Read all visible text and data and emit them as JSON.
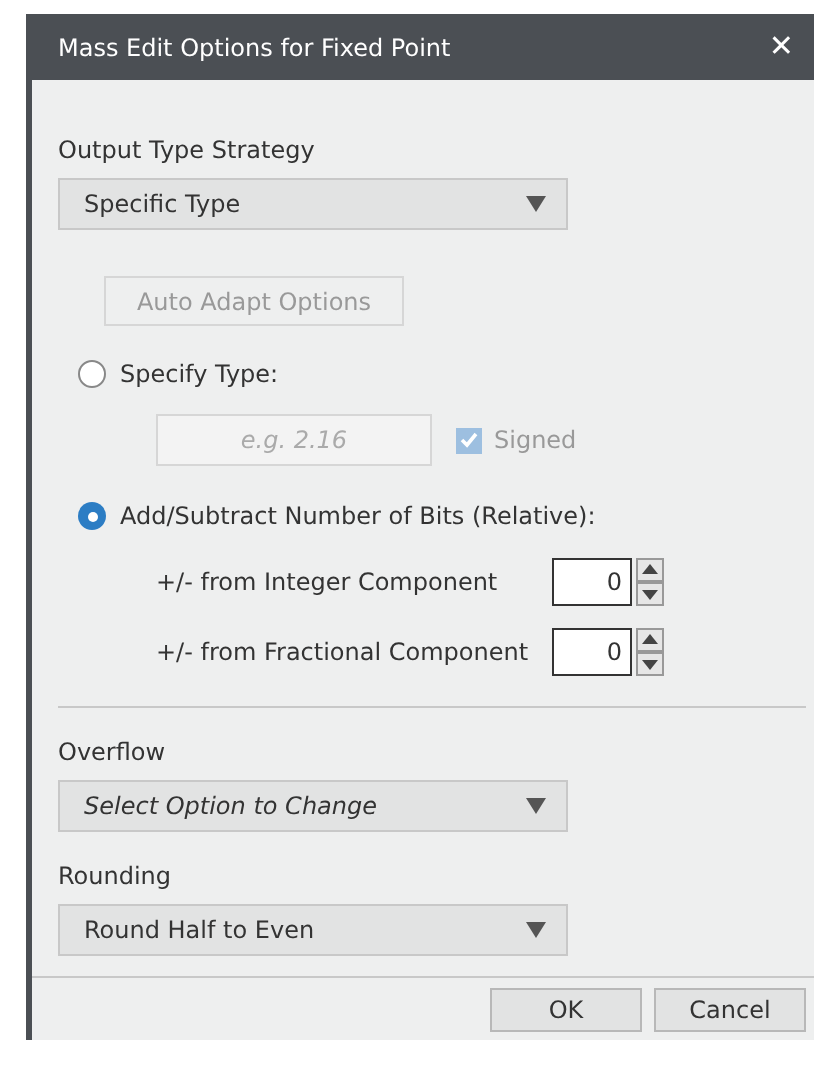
{
  "window": {
    "title": "Mass Edit Options for Fixed Point",
    "close": "✕"
  },
  "output_type": {
    "label": "Output Type Strategy",
    "value": "Specific Type"
  },
  "auto_adapt": {
    "label": "Auto Adapt Options",
    "disabled": true
  },
  "modes": [
    {
      "label": "Specify Type:",
      "selected": false
    },
    {
      "label": "Add/Subtract Number of Bits (Relative):",
      "selected": true
    }
  ],
  "type_field": {
    "placeholder": "e.g. 2.16",
    "disabled": true
  },
  "signed": {
    "label": "Signed",
    "checked": true,
    "disabled": true
  },
  "bits": [
    {
      "label": "+/- from Integer Component",
      "value": "0"
    },
    {
      "label": "+/- from Fractional Component",
      "value": "0"
    }
  ],
  "overflow": {
    "label": "Overflow",
    "placeholder": "Select Option to Change"
  },
  "rounding": {
    "label": "Rounding",
    "value": "Round Half to Even"
  },
  "buttons": [
    "OK",
    "Cancel"
  ]
}
